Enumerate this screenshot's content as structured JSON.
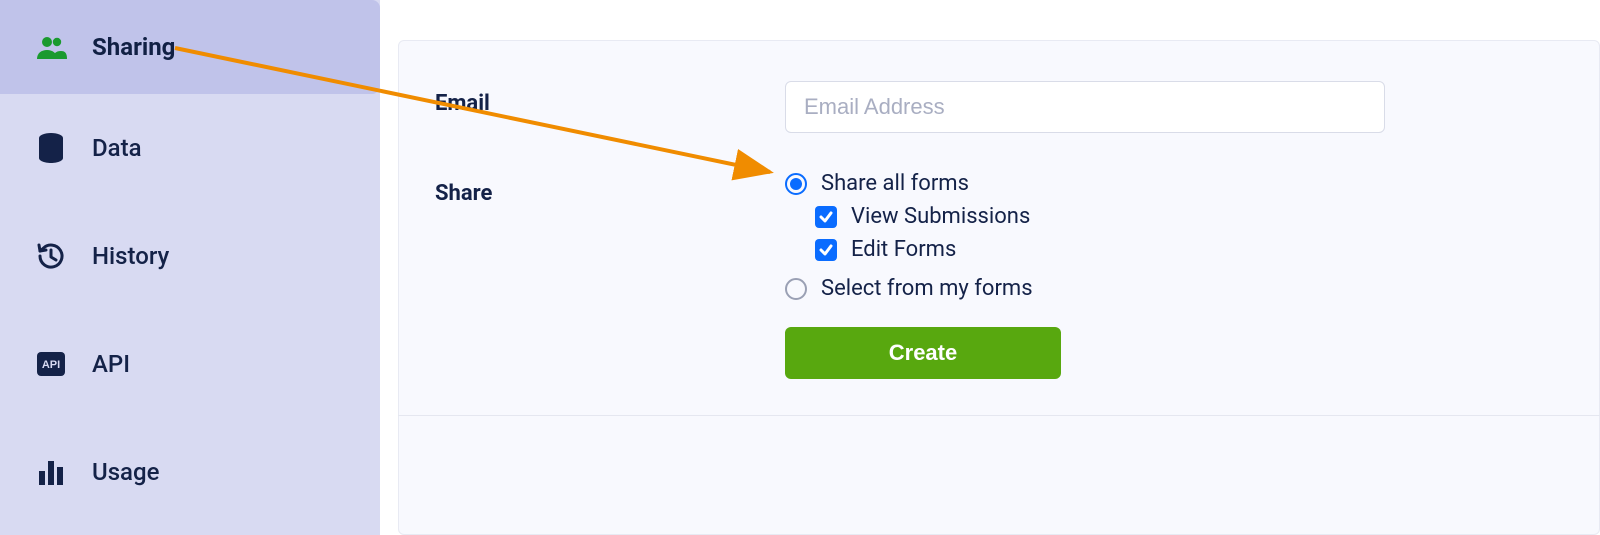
{
  "sidebar": {
    "items": [
      {
        "label": "Sharing",
        "icon": "people-icon",
        "active": true
      },
      {
        "label": "Data",
        "icon": "database-icon"
      },
      {
        "label": "History",
        "icon": "history-icon"
      },
      {
        "label": "API",
        "icon": "api-icon"
      },
      {
        "label": "Usage",
        "icon": "bar-chart-icon"
      }
    ]
  },
  "form": {
    "email_label": "Email",
    "email_placeholder": "Email Address",
    "share_label": "Share",
    "share_options": {
      "share_all": {
        "label": "Share all forms",
        "selected": true,
        "sub": {
          "view_submissions": {
            "label": "View Submissions",
            "checked": true
          },
          "edit_forms": {
            "label": "Edit Forms",
            "checked": true
          }
        }
      },
      "select_from": {
        "label": "Select from my forms",
        "selected": false
      }
    },
    "create_button": "Create"
  },
  "annotation": {
    "arrow_color": "#f08c00"
  }
}
